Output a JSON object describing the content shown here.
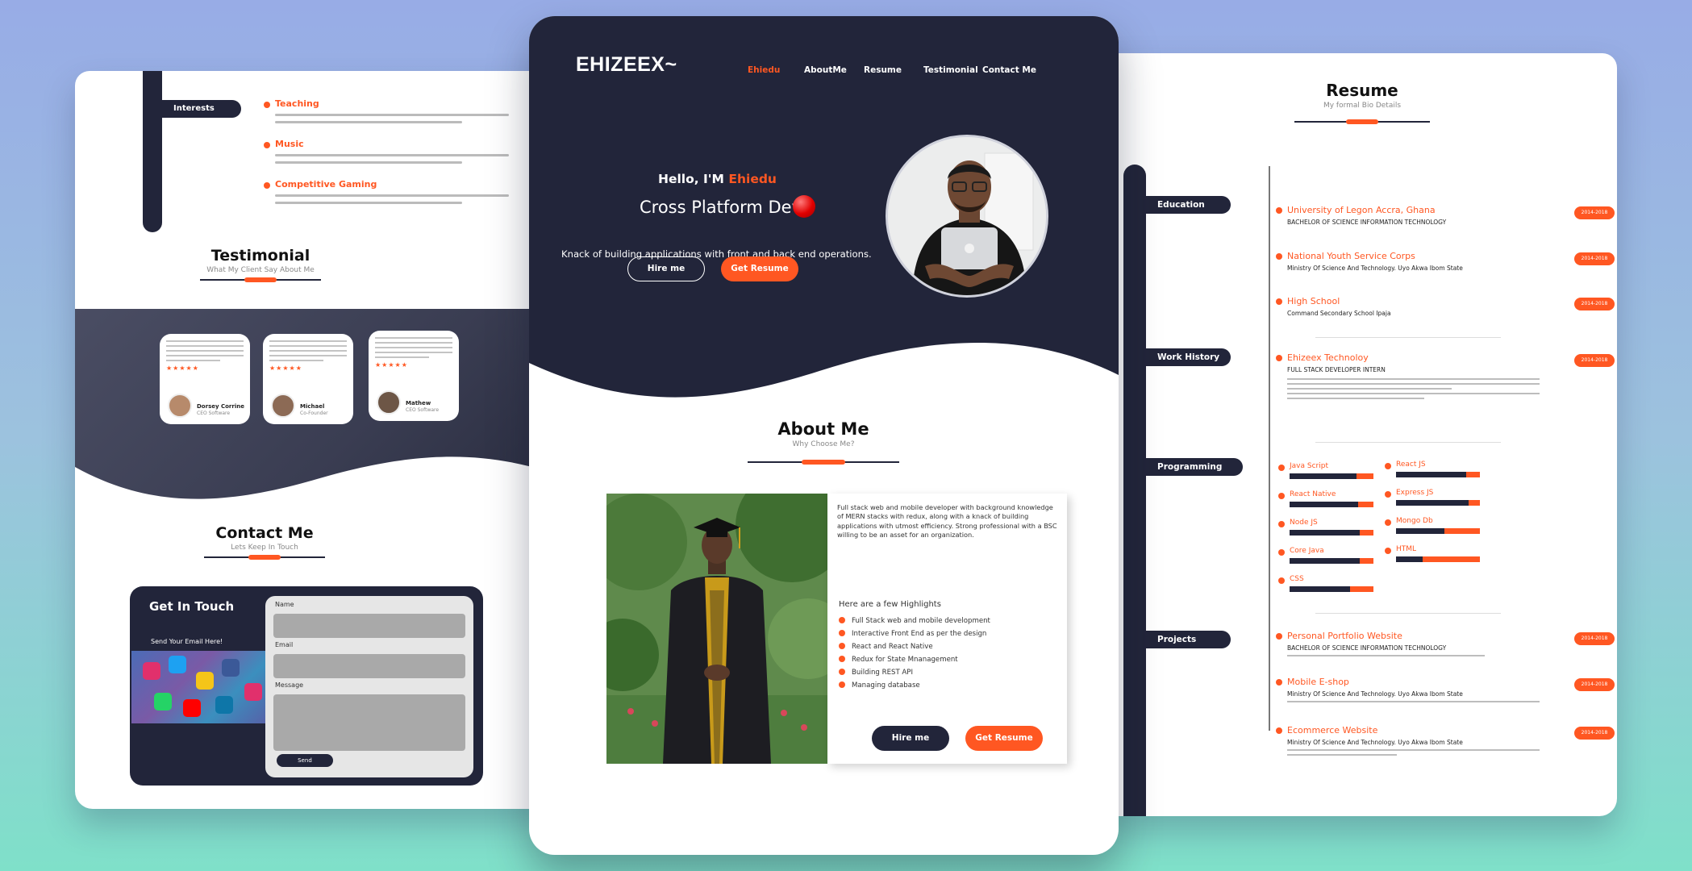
{
  "colors": {
    "navy": "#22253a",
    "accent": "#ff5722",
    "bg_top": "#98ace6",
    "bg_bottom": "#7fe0c9"
  },
  "left": {
    "interests_label": "Interests",
    "interests": [
      {
        "title": "Teaching"
      },
      {
        "title": "Music"
      },
      {
        "title": "Competitive Gaming"
      }
    ],
    "testimonial": {
      "title": "Testimonial",
      "subtitle": "What My Client Say About Me"
    },
    "testimonials": [
      {
        "name": "Dorsey Corrine",
        "role": "CEO Software",
        "stars": "★★★★★"
      },
      {
        "name": "Michael",
        "role": "Co-Founder",
        "stars": "★★★★★"
      },
      {
        "name": "Mathew",
        "role": "CEO Software",
        "stars": "★★★★★"
      }
    ],
    "contact": {
      "title": "Contact Me",
      "subtitle": "Lets Keep In Touch"
    },
    "form": {
      "heading": "Get In Touch",
      "send_email": "Send Your Email Here!",
      "name_label": "Name",
      "email_label": "Email",
      "message_label": "Message",
      "send_label": "Send"
    }
  },
  "center": {
    "logo": "EHIZEEX~",
    "nav": [
      "Ehiedu",
      "AboutMe",
      "Resume",
      "Testimonial",
      "Contact Me"
    ],
    "hello_prefix": "Hello, I'M ",
    "hello_name": "Ehiedu",
    "role": "Cross Platform Dev",
    "tagline": "Knack of building applications with front and back end operations.",
    "hire_label": "Hire me",
    "resume_label": "Get Resume",
    "about": {
      "title": "About Me",
      "subtitle": "Why Choose Me?",
      "bio": "Full stack web and mobile developer with background knowledge of MERN stacks with redux, along with a knack of building applications with utmost efficiency. Strong professional with a BSC willing to be an asset for an organization.",
      "highlights_title": "Here are a few Highlights",
      "highlights": [
        "Full Stack web and mobile development",
        "Interactive Front End as per the design",
        "React and React Native",
        "Redux for State Mnanagement",
        "Building REST API",
        "Managing database"
      ],
      "hire_label": "Hire me",
      "resume_label": "Get Resume"
    }
  },
  "right": {
    "title": "Resume",
    "subtitle": "My formal Bio Details",
    "labels": {
      "education": "Education",
      "work": "Work History",
      "skills": "Programming Skills",
      "projects": "Projects"
    },
    "education": [
      {
        "title": "University of Legon Accra, Ghana",
        "sub": "BACHELOR OF SCIENCE INFORMATION TECHNOLOGY",
        "years": "2014-2018"
      },
      {
        "title": "National Youth Service Corps",
        "sub": "Ministry Of Science And Technology. Uyo Akwa Ibom State",
        "years": "2014-2018"
      },
      {
        "title": "High School",
        "sub": "Command Secondary School Ipaja",
        "years": "2014-2018"
      }
    ],
    "work": [
      {
        "title": "Ehizeex Technoloy",
        "sub": "FULL STACK DEVELOPER INTERN",
        "years": "2014-2018"
      }
    ],
    "skills": [
      {
        "name": "Java Script",
        "level": 0.88
      },
      {
        "name": "React JS",
        "level": 0.92
      },
      {
        "name": "React Native",
        "level": 0.9
      },
      {
        "name": "Express JS",
        "level": 0.95
      },
      {
        "name": "Node JS",
        "level": 0.92
      },
      {
        "name": "Mongo Db",
        "level": 0.66
      },
      {
        "name": "Core Java",
        "level": 0.92
      },
      {
        "name": "HTML",
        "level": 0.4
      },
      {
        "name": "CSS",
        "level": 0.8
      }
    ],
    "projects": [
      {
        "title": "Personal Portfolio Website",
        "sub": "BACHELOR OF SCIENCE INFORMATION TECHNOLOGY",
        "years": "2014-2018"
      },
      {
        "title": "Mobile E-shop",
        "sub": "Ministry Of Science And Technology. Uyo Akwa Ibom State",
        "years": "2014-2018"
      },
      {
        "title": "Ecommerce Website",
        "sub": "Ministry Of Science And Technology. Uyo Akwa Ibom State",
        "years": "2014-2018"
      }
    ]
  }
}
